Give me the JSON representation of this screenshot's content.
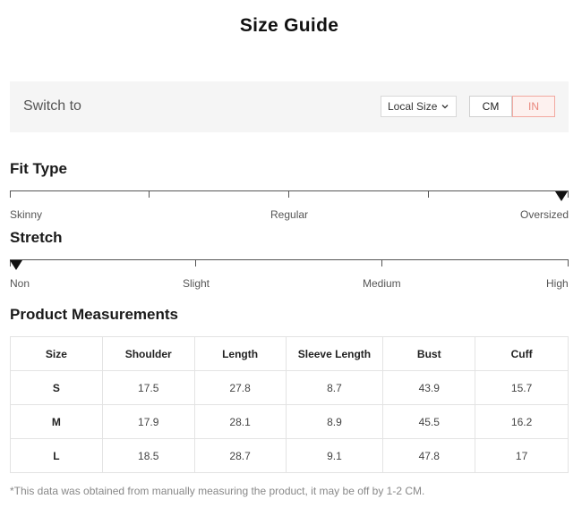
{
  "title": "Size Guide",
  "switch": {
    "label": "Switch to",
    "local_size": "Local Size",
    "unit_cm": "CM",
    "unit_in": "IN",
    "active_unit": "IN",
    "accent_color": "#e9877c"
  },
  "fit_type": {
    "title": "Fit Type",
    "labels": [
      "Skinny",
      "Regular",
      "Oversized"
    ],
    "selected": "Oversized"
  },
  "stretch": {
    "title": "Stretch",
    "labels": [
      "Non",
      "Slight",
      "Medium",
      "High"
    ],
    "selected": "Non"
  },
  "measurements": {
    "title": "Product Measurements",
    "headers": [
      "Size",
      "Shoulder",
      "Length",
      "Sleeve Length",
      "Bust",
      "Cuff"
    ],
    "rows": [
      [
        "S",
        "17.5",
        "27.8",
        "8.7",
        "43.9",
        "15.7"
      ],
      [
        "M",
        "17.9",
        "28.1",
        "8.9",
        "45.5",
        "16.2"
      ],
      [
        "L",
        "18.5",
        "28.7",
        "9.1",
        "47.8",
        "17"
      ]
    ]
  },
  "footnote": "*This data was obtained from manually measuring the product, it may be off by 1-2 CM."
}
